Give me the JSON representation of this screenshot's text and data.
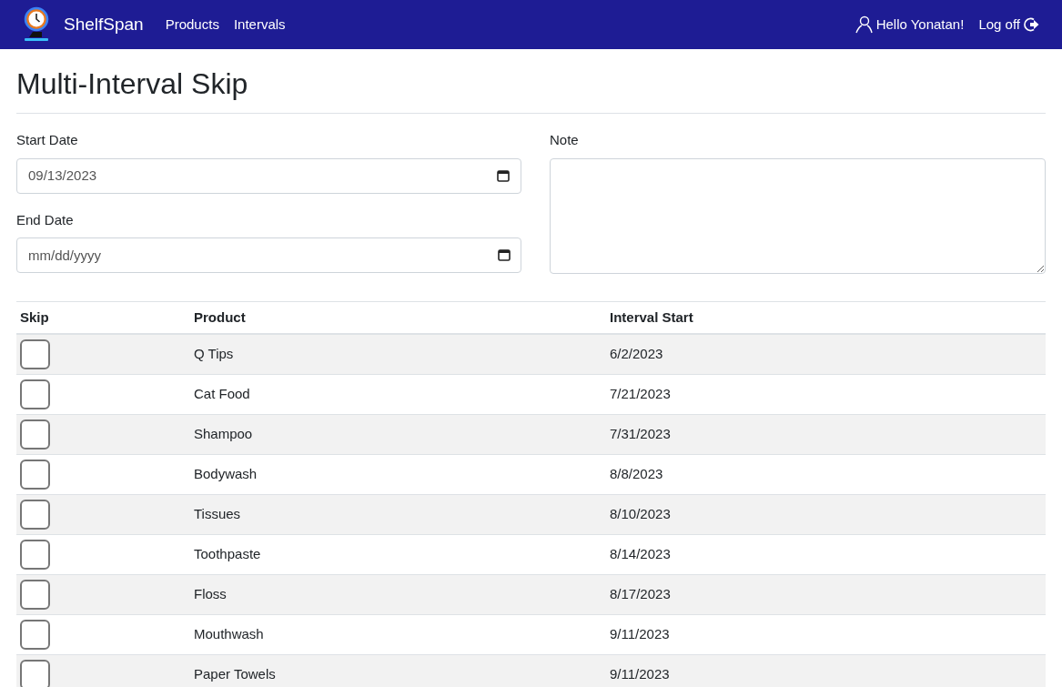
{
  "navbar": {
    "brand": "ShelfSpan",
    "links": [
      "Products",
      "Intervals"
    ],
    "greeting": "Hello Yonatan!",
    "logoff": "Log off"
  },
  "page": {
    "title": "Multi-Interval Skip"
  },
  "form": {
    "start_date": {
      "label": "Start Date",
      "value": "09/13/2023"
    },
    "end_date": {
      "label": "End Date",
      "placeholder": "mm/dd/yyyy"
    },
    "note": {
      "label": "Note"
    }
  },
  "table": {
    "columns": [
      "Skip",
      "Product",
      "Interval Start"
    ],
    "rows": [
      {
        "checked": false,
        "product": "Q Tips",
        "interval_start": "6/2/2023"
      },
      {
        "checked": false,
        "product": "Cat Food",
        "interval_start": "7/21/2023"
      },
      {
        "checked": false,
        "product": "Shampoo",
        "interval_start": "7/31/2023"
      },
      {
        "checked": false,
        "product": "Bodywash",
        "interval_start": "8/8/2023"
      },
      {
        "checked": false,
        "product": "Tissues",
        "interval_start": "8/10/2023"
      },
      {
        "checked": false,
        "product": "Toothpaste",
        "interval_start": "8/14/2023"
      },
      {
        "checked": false,
        "product": "Floss",
        "interval_start": "8/17/2023"
      },
      {
        "checked": false,
        "product": "Mouthwash",
        "interval_start": "9/11/2023"
      },
      {
        "checked": false,
        "product": "Paper Towels",
        "interval_start": "9/11/2023"
      }
    ]
  }
}
